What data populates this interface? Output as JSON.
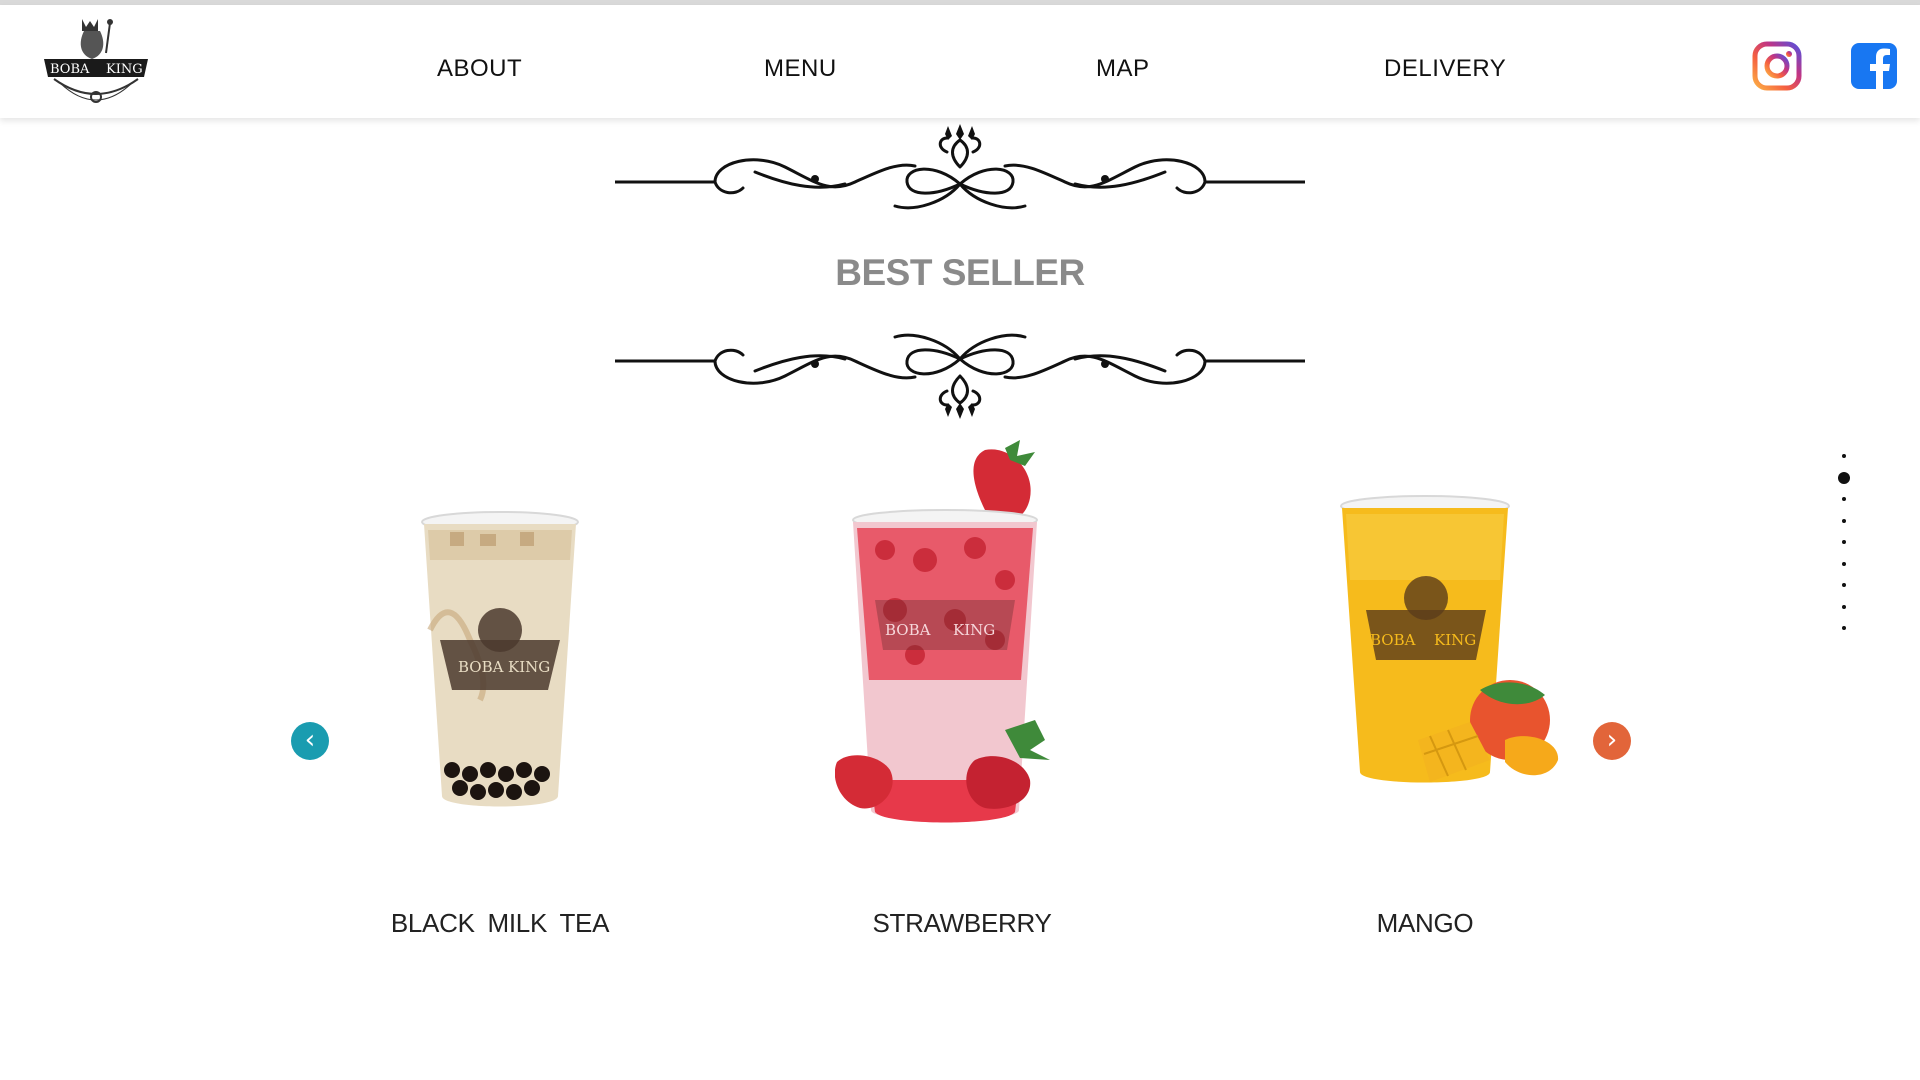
{
  "brand": {
    "logo_text_left": "BOBA",
    "logo_text_right": "KING"
  },
  "nav": {
    "items": [
      {
        "label": "ABOUT"
      },
      {
        "label": "MENU"
      },
      {
        "label": "MAP"
      },
      {
        "label": "DELIVERY"
      }
    ]
  },
  "social": {
    "instagram_icon": "instagram-icon",
    "facebook_icon": "facebook-icon",
    "instagram_color": "#C13584",
    "facebook_color": "#1877F2"
  },
  "section": {
    "title": "BEST SELLER"
  },
  "products": [
    {
      "name": "BLACK MILK TEA",
      "color": "#e8dcc3"
    },
    {
      "name": "STRAWBERRY",
      "color": "#e85a6a"
    },
    {
      "name": "MANGO",
      "color": "#f6bb1c"
    }
  ],
  "carousel": {
    "prev_icon": "chevron-left-icon",
    "next_icon": "chevron-right-icon",
    "prev_color": "#1a9cb0",
    "next_color": "#e2653a",
    "prev_glyph": "‹",
    "next_glyph": "›"
  },
  "pagination": {
    "count": 9,
    "active_index": 1
  }
}
